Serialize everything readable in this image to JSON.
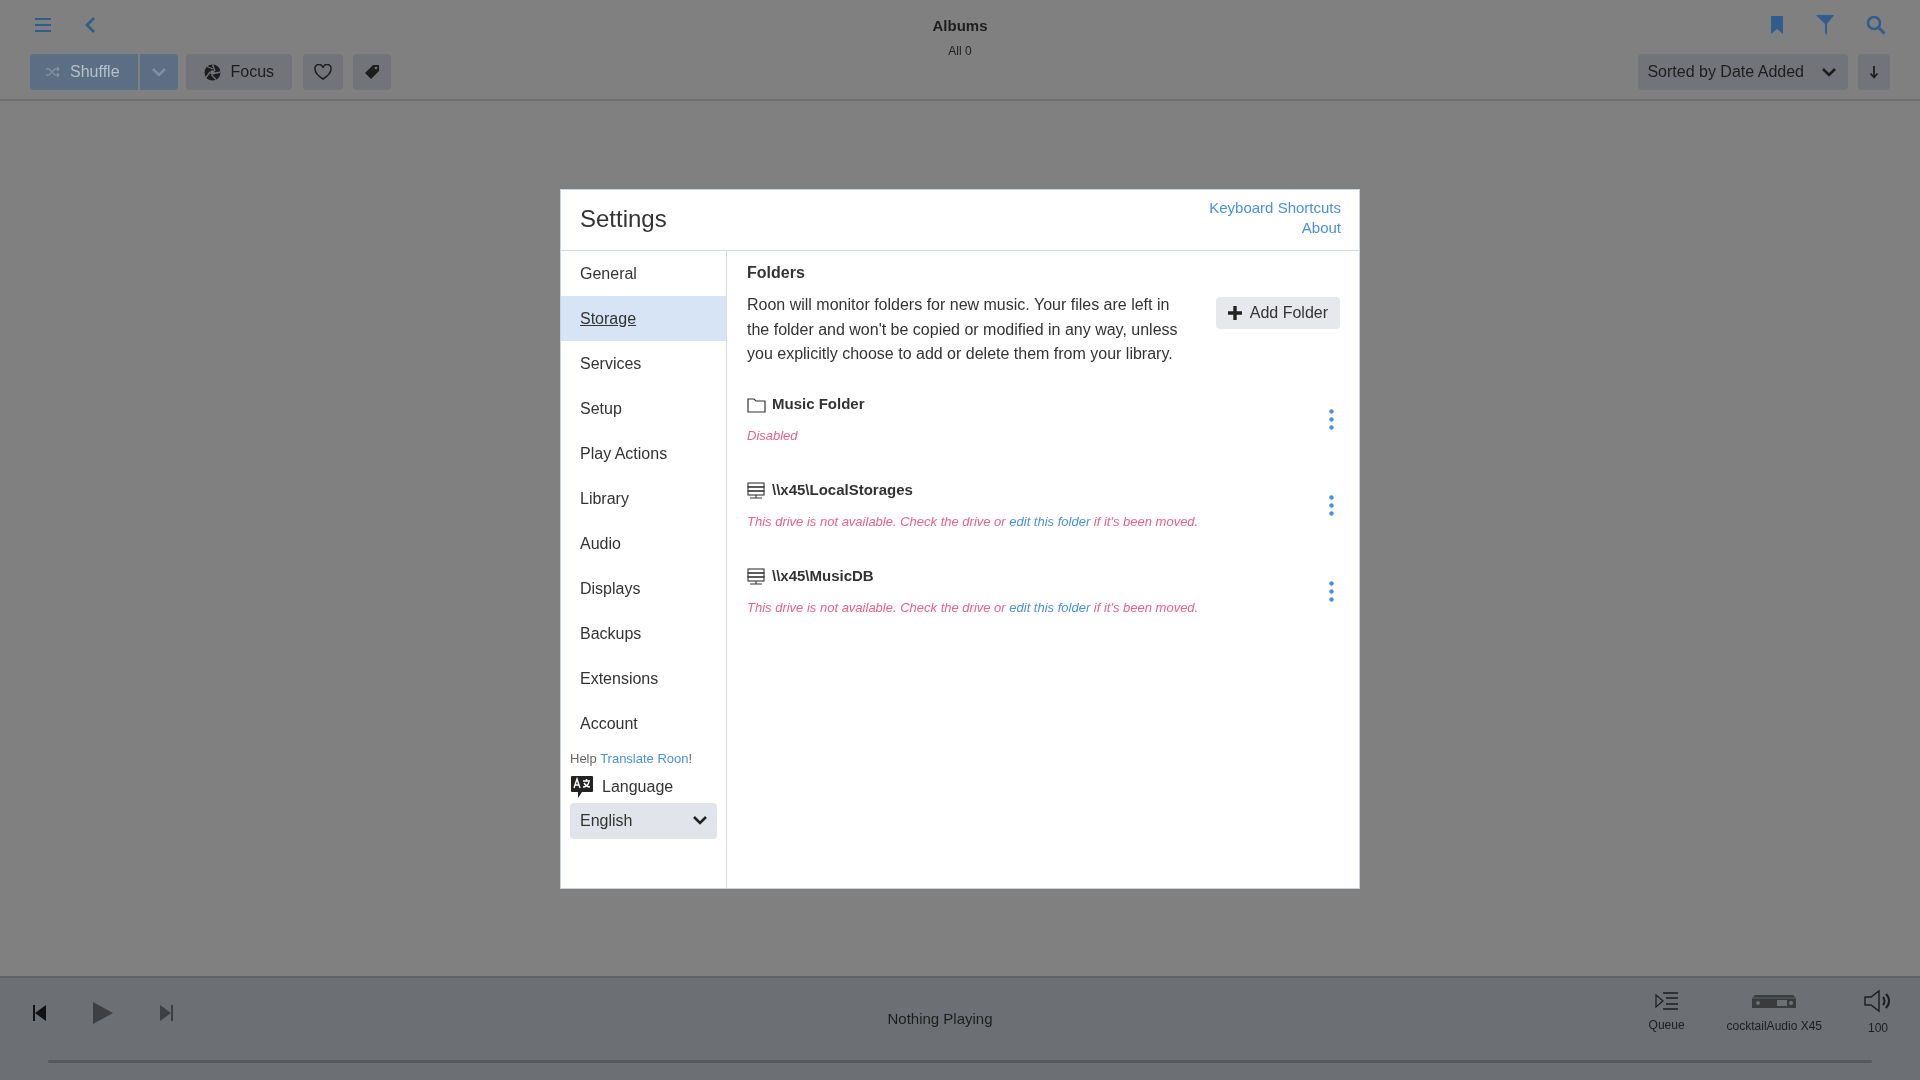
{
  "header": {
    "title": "Albums",
    "subtitle": "All 0"
  },
  "toolbar": {
    "shuffle": "Shuffle",
    "focus": "Focus",
    "sort": "Sorted by Date Added"
  },
  "settings": {
    "title": "Settings",
    "links": [
      "Keyboard Shortcuts",
      "About"
    ],
    "nav": [
      {
        "label": "General",
        "selected": false
      },
      {
        "label": "Storage",
        "selected": true
      },
      {
        "label": "Services",
        "selected": false
      },
      {
        "label": "Setup",
        "selected": false
      },
      {
        "label": "Play Actions",
        "selected": false
      },
      {
        "label": "Library",
        "selected": false
      },
      {
        "label": "Audio",
        "selected": false
      },
      {
        "label": "Displays",
        "selected": false
      },
      {
        "label": "Backups",
        "selected": false
      },
      {
        "label": "Extensions",
        "selected": false
      },
      {
        "label": "Account",
        "selected": false
      }
    ],
    "help": {
      "prefix": "Help ",
      "link": "Translate Roon",
      "suffix": "!"
    },
    "language": {
      "label": "Language",
      "value": "English"
    },
    "section_title": "Folders",
    "description": "Roon will monitor folders for new music. Your files are left in the folder and won't be copied or modified in any way, unless you explicitly choose to add or delete them from your library.",
    "add_button": "Add Folder",
    "folders": [
      {
        "kind": "folder",
        "name": "Music Folder",
        "status": "Disabled"
      },
      {
        "kind": "drive",
        "name": "\\\\x45\\LocalStorages",
        "message": {
          "before": "This drive is not available. Check the drive or ",
          "link": "edit this folder",
          "after": " if it's been moved."
        }
      },
      {
        "kind": "drive",
        "name": "\\\\x45\\MusicDB",
        "message": {
          "before": "This drive is not available. Check the drive or ",
          "link": "edit this folder",
          "after": " if it's been moved."
        }
      }
    ]
  },
  "player": {
    "status": "Nothing Playing",
    "queue": "Queue",
    "device": "cocktailAudio X45",
    "volume": "100",
    "level": 0
  }
}
